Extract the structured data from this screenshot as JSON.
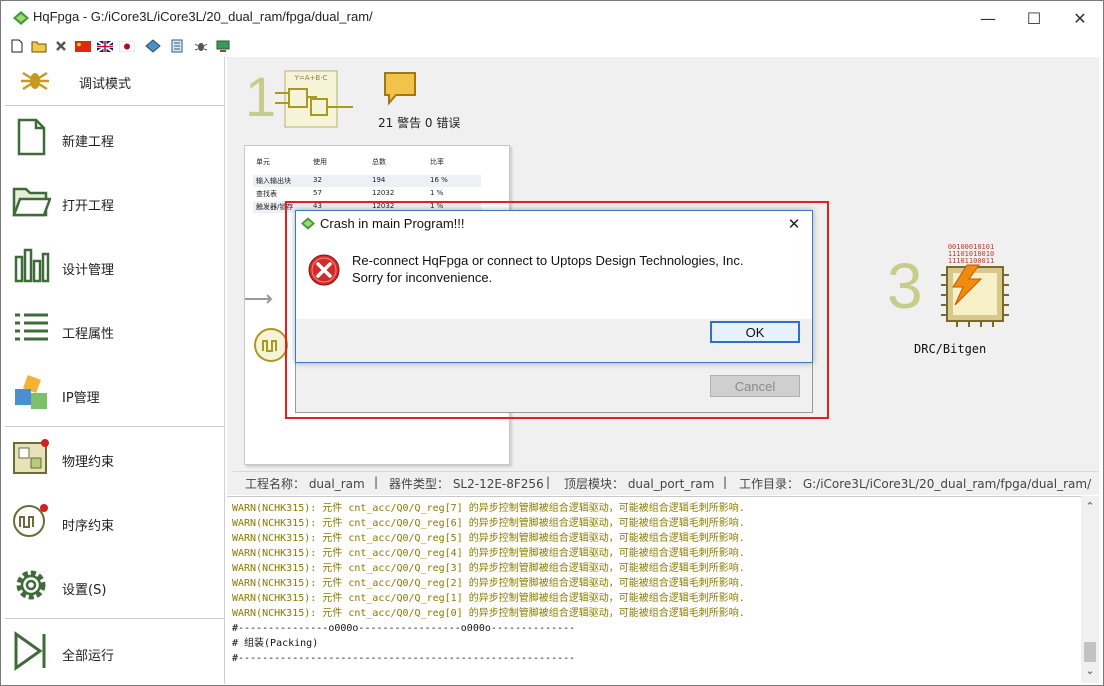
{
  "window": {
    "title": "HqFpga - G:/iCore3L/iCore3L/20_dual_ram/fpga/dual_ram/",
    "minimize_glyph": "—",
    "maximize_glyph": "☐",
    "close_glyph": "✕"
  },
  "toolbar": {
    "icons": [
      "new-file-icon",
      "open-folder-icon",
      "delete-icon",
      "flag-china-icon",
      "flag-uk-icon",
      "flag-japan-icon",
      "chip-settings-icon",
      "document-icon",
      "bug-icon",
      "monitor-icon"
    ]
  },
  "sidebar": {
    "items": [
      {
        "label": "调试模式",
        "icon": "debug-bug-icon"
      },
      {
        "label": "新建工程",
        "icon": "new-project-icon"
      },
      {
        "label": "打开工程",
        "icon": "open-project-icon"
      },
      {
        "label": "设计管理",
        "icon": "design-manage-icon"
      },
      {
        "label": "工程属性",
        "icon": "project-properties-icon"
      },
      {
        "label": "IP管理",
        "icon": "ip-manage-icon"
      },
      {
        "label": "物理约束",
        "icon": "physical-constraint-icon"
      },
      {
        "label": "时序约束",
        "icon": "timing-constraint-icon"
      },
      {
        "label": "设置(S)",
        "icon": "settings-gear-icon"
      },
      {
        "label": "全部运行",
        "icon": "run-all-icon"
      }
    ]
  },
  "flow": {
    "step1_number": "1",
    "step1_chip_text": "Y=A+B·C",
    "step3_number": "3",
    "step3_chip_text_1": "00100010101",
    "step3_chip_text_2": "11101010010",
    "step3_chip_text_3": "11101100011",
    "step3_label": "DRC/Bitgen",
    "messages_summary": "21 警告 0 错误"
  },
  "resource_table": {
    "headers": [
      "单元",
      "使用",
      "总数",
      "比率"
    ],
    "rows": [
      [
        "输入输出块",
        "32",
        "194",
        "16 %"
      ],
      [
        "查找表",
        "57",
        "12032",
        "1 %"
      ],
      [
        "触发器/锁存",
        "43",
        "12032",
        "1 %"
      ]
    ]
  },
  "dialog": {
    "title": "Crash in main Program!!!",
    "message_line1": "Re-connect HqFpga or connect to Uptops Design Technologies, Inc.",
    "message_line2": "Sorry for inconvenience.",
    "ok_label": "OK",
    "close_glyph": "✕",
    "cancel_label": "Cancel"
  },
  "status_path": {
    "project_name": "工程名称： dual_ram",
    "device_type": "器件类型： SL2-12E-8F256",
    "top_module": "顶层模块： dual_port_ram",
    "work_dir": "工作目录： G:/iCore3L/iCore3L/20_dual_ram/fpga/dual_ram/",
    "sep": "|"
  },
  "log": {
    "lines": [
      {
        "text": "WARN(NCHK315): 元件 cnt_acc/Q0/Q_reg[7] 的异步控制管脚被组合逻辑驱动，可能被组合逻辑毛刺所影响.",
        "kind": "warn"
      },
      {
        "text": "WARN(NCHK315): 元件 cnt_acc/Q0/Q_reg[6] 的异步控制管脚被组合逻辑驱动，可能被组合逻辑毛刺所影响.",
        "kind": "warn"
      },
      {
        "text": "WARN(NCHK315): 元件 cnt_acc/Q0/Q_reg[5] 的异步控制管脚被组合逻辑驱动，可能被组合逻辑毛刺所影响.",
        "kind": "warn"
      },
      {
        "text": "WARN(NCHK315): 元件 cnt_acc/Q0/Q_reg[4] 的异步控制管脚被组合逻辑驱动，可能被组合逻辑毛刺所影响.",
        "kind": "warn"
      },
      {
        "text": "WARN(NCHK315): 元件 cnt_acc/Q0/Q_reg[3] 的异步控制管脚被组合逻辑驱动，可能被组合逻辑毛刺所影响.",
        "kind": "warn"
      },
      {
        "text": "WARN(NCHK315): 元件 cnt_acc/Q0/Q_reg[2] 的异步控制管脚被组合逻辑驱动，可能被组合逻辑毛刺所影响.",
        "kind": "warn"
      },
      {
        "text": "WARN(NCHK315): 元件 cnt_acc/Q0/Q_reg[1] 的异步控制管脚被组合逻辑驱动，可能被组合逻辑毛刺所影响.",
        "kind": "warn"
      },
      {
        "text": "WARN(NCHK315): 元件 cnt_acc/Q0/Q_reg[0] 的异步控制管脚被组合逻辑驱动，可能被组合逻辑毛刺所影响.",
        "kind": "warn"
      },
      {
        "text": "#---------------o000o-----------------o000o--------------",
        "kind": "info"
      },
      {
        "text": "# 组装(Packing)",
        "kind": "info"
      },
      {
        "text": "#--------------------------------------------------------",
        "kind": "info"
      }
    ]
  },
  "scroll": {
    "up_glyph": "⌃",
    "down_glyph": "⌄"
  },
  "colors": {
    "warn": "#8a7a00",
    "info": "#111111",
    "highlight_frame": "#e62020",
    "ok_border": "#2f6fc8",
    "step_number": "#c8cc8a"
  }
}
